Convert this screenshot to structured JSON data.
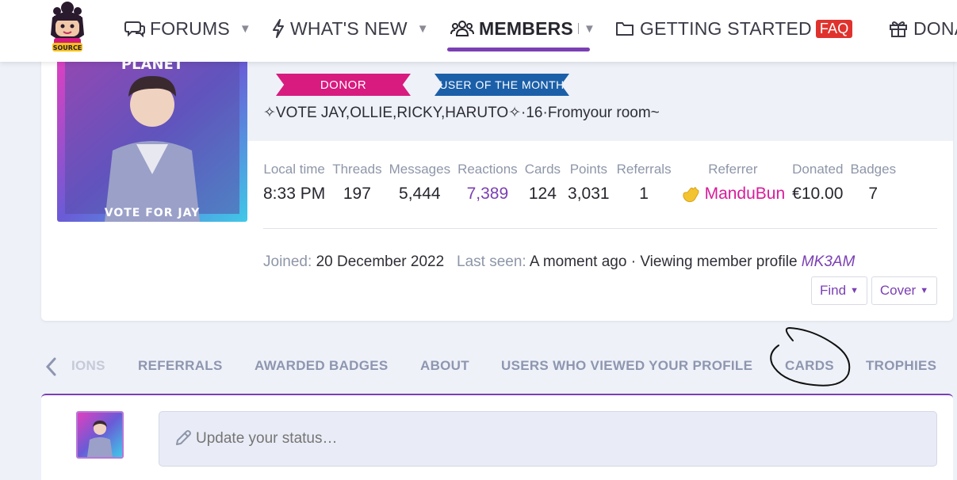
{
  "nav": {
    "items": [
      {
        "label": "FORUMS",
        "icon": "comments-icon"
      },
      {
        "label": "WHAT'S NEW",
        "icon": "bolt-icon"
      },
      {
        "label": "MEMBERS",
        "icon": "users-icon"
      },
      {
        "label": "GETTING STARTED",
        "icon": "folder-icon",
        "badge": "FAQ"
      },
      {
        "label": "DONA",
        "icon": "gift-icon"
      }
    ],
    "logo_text": "SOURCE"
  },
  "profile": {
    "banners": {
      "donor": "DONOR",
      "uotm": "USER OF THE MONTH"
    },
    "custom_title": "✧VOTE JAY,OLLIE,RICKY,HARUTO✧·16·Fromyour room~",
    "avatar_caption_top": "PLANET",
    "avatar_caption_bottom": "VOTE FOR JAY",
    "stats": [
      {
        "label": "Local time",
        "value": "8:33 PM"
      },
      {
        "label": "Threads",
        "value": "197"
      },
      {
        "label": "Messages",
        "value": "5,444"
      },
      {
        "label": "Reactions",
        "value": "7,389"
      },
      {
        "label": "Cards",
        "value": "124"
      },
      {
        "label": "Points",
        "value": "3,031"
      },
      {
        "label": "Referrals",
        "value": "1"
      },
      {
        "label": "Referrer",
        "value": "ManduBun"
      },
      {
        "label": "Donated",
        "value": "€10.00"
      },
      {
        "label": "Badges",
        "value": "7"
      }
    ],
    "joined_label": "Joined:",
    "joined_value": "20 December 2022",
    "last_seen_label": "Last seen:",
    "last_seen_value": "A moment ago · Viewing member profile",
    "last_seen_target": "MK3AM",
    "find_label": "Find",
    "cover_label": "Cover"
  },
  "tabs": [
    "IONS",
    "REFERRALS",
    "AWARDED BADGES",
    "ABOUT",
    "USERS WHO VIEWED YOUR PROFILE",
    "CARDS",
    "TROPHIES"
  ],
  "status": {
    "placeholder": "Update your status…"
  },
  "colors": {
    "accent": "#7b3fb3",
    "pink": "#d81b9a",
    "faq_red": "#e0322d"
  }
}
